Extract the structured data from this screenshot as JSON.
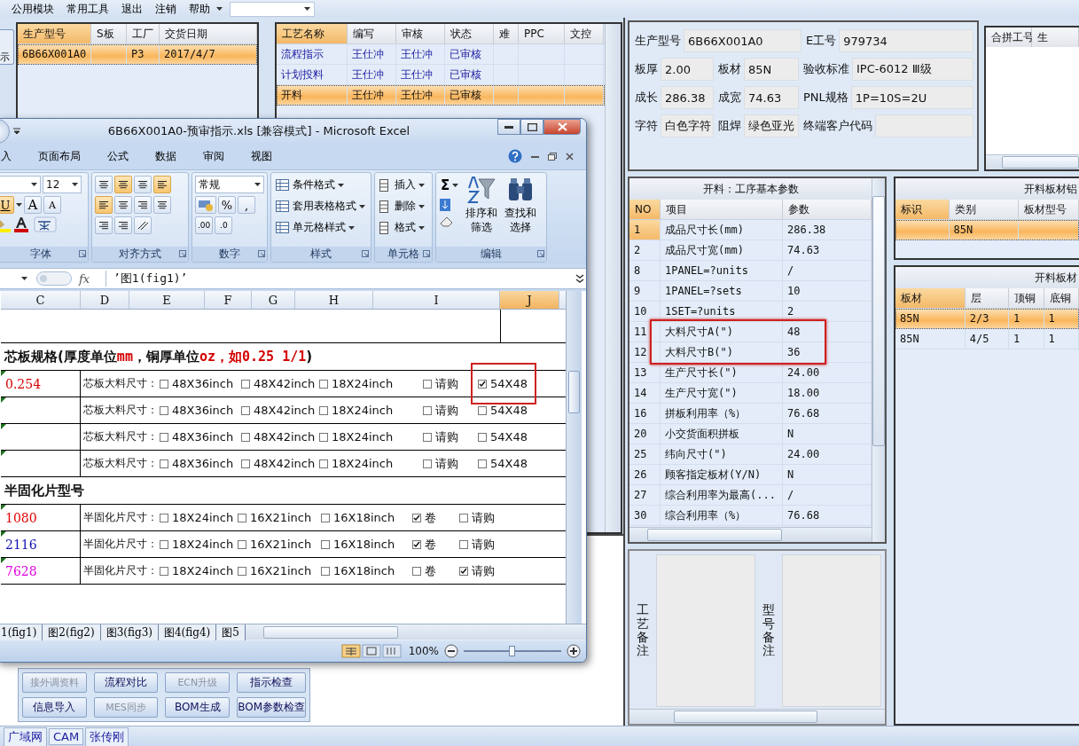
{
  "menu": {
    "items": [
      "公用模块",
      "常用工具",
      "退出",
      "注销",
      "帮助"
    ]
  },
  "left_strip": {
    "button_label": "示"
  },
  "product_table": {
    "columns": [
      "生产型号",
      "S板",
      "工厂",
      "交货日期"
    ],
    "rows": [
      {
        "model": "6B66X001A0",
        "factory": "P3",
        "date": "2017/4/7",
        "selected": true
      }
    ]
  },
  "process_table": {
    "columns": [
      "工艺名称",
      "编写",
      "审核",
      "状态",
      "难",
      "PPC",
      "文控"
    ],
    "rows": [
      {
        "name": "流程指示",
        "author": "王仕冲",
        "reviewer": "王仕冲",
        "status": "已审核",
        "selected": false
      },
      {
        "name": "计划投料",
        "author": "王仕冲",
        "reviewer": "王仕冲",
        "status": "已审核",
        "selected": false
      },
      {
        "name": "开料",
        "author": "王仕冲",
        "reviewer": "王仕冲",
        "status": "已审核",
        "selected": true
      }
    ]
  },
  "button_panel": {
    "buttons": [
      {
        "label": "接外调资料",
        "disabled": true
      },
      {
        "label": "流程对比",
        "disabled": false
      },
      {
        "label": "ECN升级",
        "disabled": true
      },
      {
        "label": "指示检查",
        "disabled": false
      },
      {
        "label": "信息导入",
        "disabled": false
      },
      {
        "label": "MES同步",
        "disabled": true
      },
      {
        "label": "BOM生成",
        "disabled": false
      },
      {
        "label": "BOM参数检查",
        "disabled": false
      }
    ]
  },
  "info_panel": {
    "fields": [
      {
        "label": "生产型号",
        "value": "6B66X001A0"
      },
      {
        "label": "E工号",
        "value": "979734"
      },
      {
        "label": "板厚",
        "value": "2.00"
      },
      {
        "label": "板材",
        "value": "85N"
      },
      {
        "label": "验收标准",
        "value": "IPC-6012 Ⅲ级"
      },
      {
        "label": "成长",
        "value": "286.38"
      },
      {
        "label": "成宽",
        "value": "74.63"
      },
      {
        "label": "PNL规格",
        "value": "1P=10S=2U"
      },
      {
        "label": "字符",
        "value": "白色字符"
      },
      {
        "label": "阻焊",
        "value": "绿色亚光"
      },
      {
        "label": "终端客户代码"
      }
    ]
  },
  "merge_table": {
    "columns": [
      "合拼工号",
      "生"
    ]
  },
  "params_table": {
    "title": "开料：工序基本参数",
    "columns": [
      "NO",
      "项目",
      "参数"
    ],
    "rows": [
      {
        "no": "1",
        "item": "成品尺寸长(mm)",
        "value": "286.38",
        "selected": true,
        "boxed": false
      },
      {
        "no": "2",
        "item": "成品尺寸宽(mm)",
        "value": "74.63",
        "selected": false,
        "boxed": false
      },
      {
        "no": "8",
        "item": "1PANEL=?units",
        "value": "/",
        "selected": false,
        "boxed": false
      },
      {
        "no": "9",
        "item": "1PANEL=?sets",
        "value": "10",
        "selected": false,
        "boxed": false
      },
      {
        "no": "10",
        "item": "1SET=?units",
        "value": "2",
        "selected": false,
        "boxed": false
      },
      {
        "no": "11",
        "item": "大料尺寸A(\")",
        "value": "48",
        "selected": false,
        "boxed": true
      },
      {
        "no": "12",
        "item": "大料尺寸B(\")",
        "value": "36",
        "selected": false,
        "boxed": true
      },
      {
        "no": "13",
        "item": "生产尺寸长(\")",
        "value": "24.00",
        "selected": false,
        "boxed": false
      },
      {
        "no": "14",
        "item": "生产尺寸宽(\")",
        "value": "18.00",
        "selected": false,
        "boxed": false
      },
      {
        "no": "16",
        "item": "拼板利用率（%）",
        "value": "76.68",
        "selected": false,
        "boxed": false
      },
      {
        "no": "20",
        "item": "小交货面积拼板",
        "value": "N",
        "selected": false,
        "boxed": false
      },
      {
        "no": "25",
        "item": "纬向尺寸(\")",
        "value": "24.00",
        "selected": false,
        "boxed": false
      },
      {
        "no": "26",
        "item": "顾客指定板材(Y/N)",
        "value": "N",
        "selected": false,
        "boxed": false
      },
      {
        "no": "27",
        "item": "综合利用率为最高(...",
        "value": "/",
        "selected": false,
        "boxed": false
      },
      {
        "no": "30",
        "item": "综合利用率（%）",
        "value": "76.68",
        "selected": false,
        "boxed": false
      }
    ]
  },
  "sheet_table": {
    "title": "开料板材铝",
    "columns": [
      "标识",
      "类别",
      "板材型号"
    ],
    "rows": [
      {
        "type": "85N",
        "selected": true
      }
    ]
  },
  "board_table": {
    "title": "开料板材",
    "columns": [
      "板材",
      "层",
      "顶铜",
      "底铜"
    ],
    "rows": [
      {
        "cells": [
          "85N",
          "2/3",
          "1",
          "1"
        ],
        "selected": true
      },
      {
        "cells": [
          "85N",
          "4/5",
          "1",
          "1"
        ],
        "selected": false
      }
    ]
  },
  "remarks": [
    {
      "label": "工艺备注"
    },
    {
      "label": "型号备注"
    }
  ],
  "status_bar": [
    "广域网",
    "CAM",
    "张传刚"
  ],
  "excel": {
    "title": "6B66X001A0-预审指示.xls  [兼容模式] - Microsoft Excel",
    "tabs": [
      "入",
      "页面布局",
      "公式",
      "数据",
      "审阅",
      "视图"
    ],
    "font_size": "12",
    "font_buttons": [
      "U",
      "A",
      "A"
    ],
    "number_format": "常规",
    "number_buttons": [
      "%",
      ","
    ],
    "decimal_buttons": [
      ".00",
      ".0"
    ],
    "groups": [
      "字体",
      "对齐方式",
      "数字",
      "样式",
      "单元格",
      "编辑"
    ],
    "style_commands": [
      "条件格式",
      "套用表格格式",
      "单元格样式"
    ],
    "cell_commands": [
      "插入",
      "删除",
      "格式"
    ],
    "sum": "Σ",
    "edit_commands": [
      "排序和筛选",
      "查找和选择"
    ],
    "formula": {
      "fx": "fx",
      "value": "’图1(fig1)’"
    },
    "columns": [
      {
        "label": "C",
        "selected": false
      },
      {
        "label": "D",
        "selected": false
      },
      {
        "label": "E",
        "selected": false
      },
      {
        "label": "F",
        "selected": false
      },
      {
        "label": "G",
        "selected": false
      },
      {
        "label": "H",
        "selected": false
      },
      {
        "label": "I",
        "selected": false
      },
      {
        "label": "J",
        "selected": true
      }
    ],
    "core_heading": [
      {
        "text": "芯板规格(厚度单位",
        "highlight": false
      },
      {
        "text": "mm",
        "highlight": true
      },
      {
        "text": "，铜厚单位",
        "highlight": false
      },
      {
        "text": "oz，如0.25 1/1",
        "highlight": true
      },
      {
        "text": ")",
        "highlight": false
      }
    ],
    "core_rows": [
      {
        "value": "0.254",
        "color": "#d40000",
        "label": "芯板大料尺寸：",
        "options": [
          {
            "label": "48X36inch",
            "checked": false,
            "boxed": false
          },
          {
            "label": "48X42inch",
            "checked": false,
            "boxed": false
          },
          {
            "label": "18X24inch",
            "checked": false,
            "boxed": false
          },
          {
            "label": "请购",
            "checked": false,
            "boxed": false
          },
          {
            "label": "54X48",
            "checked": true,
            "boxed": true
          }
        ]
      },
      {
        "label": "芯板大料尺寸：",
        "options": [
          {
            "label": "48X36inch",
            "checked": false,
            "boxed": false
          },
          {
            "label": "48X42inch",
            "checked": false,
            "boxed": false
          },
          {
            "label": "18X24inch",
            "checked": false,
            "boxed": false
          },
          {
            "label": "请购",
            "checked": false,
            "boxed": false
          },
          {
            "label": "54X48",
            "checked": false,
            "boxed": false
          }
        ]
      },
      {
        "label": "芯板大料尺寸：",
        "options": [
          {
            "label": "48X36inch",
            "checked": false,
            "boxed": false
          },
          {
            "label": "48X42inch",
            "checked": false,
            "boxed": false
          },
          {
            "label": "18X24inch",
            "checked": false,
            "boxed": false
          },
          {
            "label": "请购",
            "checked": false,
            "boxed": false
          },
          {
            "label": "54X48",
            "checked": false,
            "boxed": false
          }
        ]
      },
      {
        "label": "芯板大料尺寸：",
        "options": [
          {
            "label": "48X36inch",
            "checked": false,
            "boxed": false
          },
          {
            "label": "48X42inch",
            "checked": false,
            "boxed": false
          },
          {
            "label": "18X24inch",
            "checked": false,
            "boxed": false
          },
          {
            "label": "请购",
            "checked": false,
            "boxed": false
          },
          {
            "label": "54X48",
            "checked": false,
            "boxed": false
          }
        ]
      }
    ],
    "prepreg_heading": "半固化片型号",
    "prepreg_rows": [
      {
        "value": "1080",
        "color": "#e00000",
        "label": "半固化片尺寸：",
        "options": [
          {
            "label": "18X24inch",
            "checked": false,
            "boxed": false
          },
          {
            "label": "16X21inch",
            "checked": false,
            "boxed": false
          },
          {
            "label": "16X18inch",
            "checked": false,
            "boxed": false
          },
          {
            "label": "卷",
            "checked": true,
            "boxed": false
          },
          {
            "label": "请购",
            "checked": false,
            "boxed": false
          }
        ]
      },
      {
        "value": "2116",
        "color": "#1010b0",
        "label": "半固化片尺寸：",
        "options": [
          {
            "label": "18X24inch",
            "checked": false,
            "boxed": false
          },
          {
            "label": "16X21inch",
            "checked": false,
            "boxed": false
          },
          {
            "label": "16X18inch",
            "checked": false,
            "boxed": false
          },
          {
            "label": "卷",
            "checked": true,
            "boxed": false
          },
          {
            "label": "请购",
            "checked": false,
            "boxed": false
          }
        ]
      },
      {
        "value": "7628",
        "color": "#e000e0",
        "label": "半固化片尺寸：",
        "options": [
          {
            "label": "18X24inch",
            "checked": false,
            "boxed": false
          },
          {
            "label": "16X21inch",
            "checked": false,
            "boxed": false
          },
          {
            "label": "16X18inch",
            "checked": false,
            "boxed": false
          },
          {
            "label": "卷",
            "checked": false,
            "boxed": false
          },
          {
            "label": "请购",
            "checked": true,
            "boxed": false
          }
        ]
      }
    ],
    "sheet_tabs": [
      "1(fig1)",
      "图2(fig2)",
      "图3(fig3)",
      "图4(fig4)",
      "图5"
    ],
    "zoom": {
      "label": "100%",
      "level": 0.5
    }
  }
}
